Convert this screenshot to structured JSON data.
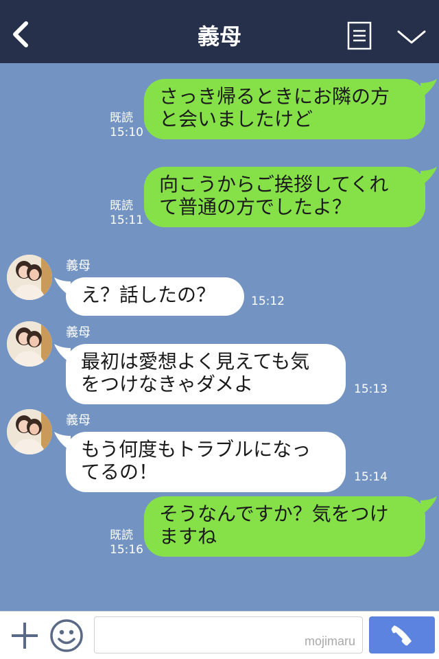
{
  "header": {
    "title": "義母"
  },
  "colors": {
    "header_bg": "#26304a",
    "chat_bg": "#7394c3",
    "outgoing_bubble": "#86e148",
    "incoming_bubble": "#ffffff",
    "send_button": "#5b83df"
  },
  "icons": {
    "back": "chevron-left-icon",
    "menu": "document-menu-icon",
    "collapse": "chevron-down-icon",
    "attach": "plus-icon",
    "sticker": "smile-icon",
    "call": "phone-icon"
  },
  "messages": [
    {
      "dir": "out",
      "lines": [
        "さっき帰るときにお隣の方",
        "と会いましたけど"
      ],
      "read": "既読",
      "time": "15:10"
    },
    {
      "dir": "out",
      "lines": [
        "向こうからご挨拶してくれ",
        "て普通の方でしたよ？"
      ],
      "read": "既読",
      "time": "15:11"
    },
    {
      "dir": "in",
      "sender": "義母",
      "lines": [
        "え？話したの？"
      ],
      "time": "15:12"
    },
    {
      "dir": "in",
      "sender": "義母",
      "lines": [
        "最初は愛想よく見えても気",
        "をつけなきゃダメよ"
      ],
      "time": "15:13"
    },
    {
      "dir": "in",
      "sender": "義母",
      "lines": [
        "もう何度もトラブルになっ",
        "てるの！"
      ],
      "time": "15:14"
    },
    {
      "dir": "out",
      "lines": [
        "そうなんですか？気をつけ",
        "ますね"
      ],
      "read": "既読",
      "time": "15:16"
    }
  ],
  "footer": {
    "watermark": "mojimaru"
  }
}
